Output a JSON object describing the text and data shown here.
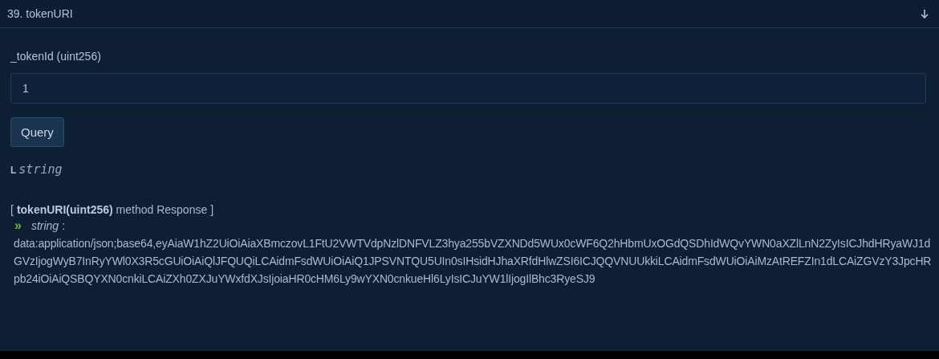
{
  "header": {
    "title": "39. tokenURI"
  },
  "input": {
    "label": "_tokenId (uint256)",
    "value": "1"
  },
  "query_button": {
    "label": "Query"
  },
  "output_type": {
    "marker": "L",
    "type": "string"
  },
  "response": {
    "title": "**tokenURI(uint256)** method Response",
    "bracket_open": "[",
    "bracket_close": "]",
    "marker": "»",
    "type": "string",
    "separator": ":",
    "value": "data:application/json;base64,eyAiaW1hZ2UiOiAiaXBmczovL1FtU2VWTVdpNzlDNFVLZ3hya255bVZXNDd5WUx0cWF6Q2hHbmUxOGdQSDhIdWQvYWN0aXZlLnN2ZyIsICJhdHRyaWJ1dGVzIjogWyB7InRyYWl0X3R5cGUiOiAiQlJFQUQiLCAidmFsdWUiOiAiQ1JPSVNTQU5UIn0sIHsidHJhaXRfdHlwZSI6ICJQQVNUUkkiLCAidmFsdWUiOiAiMzAtREFZIn1dLCAiZGVzY3JpcHRpb24iOiAiQSBQYXN0cnkiLCAiZXh0ZXJuYWxfdXJsIjoiaHR0cHM6Ly9wYXN0cnkueHl6LyIsICJuYW1lIjogIlBhc3RyeSJ9"
  }
}
